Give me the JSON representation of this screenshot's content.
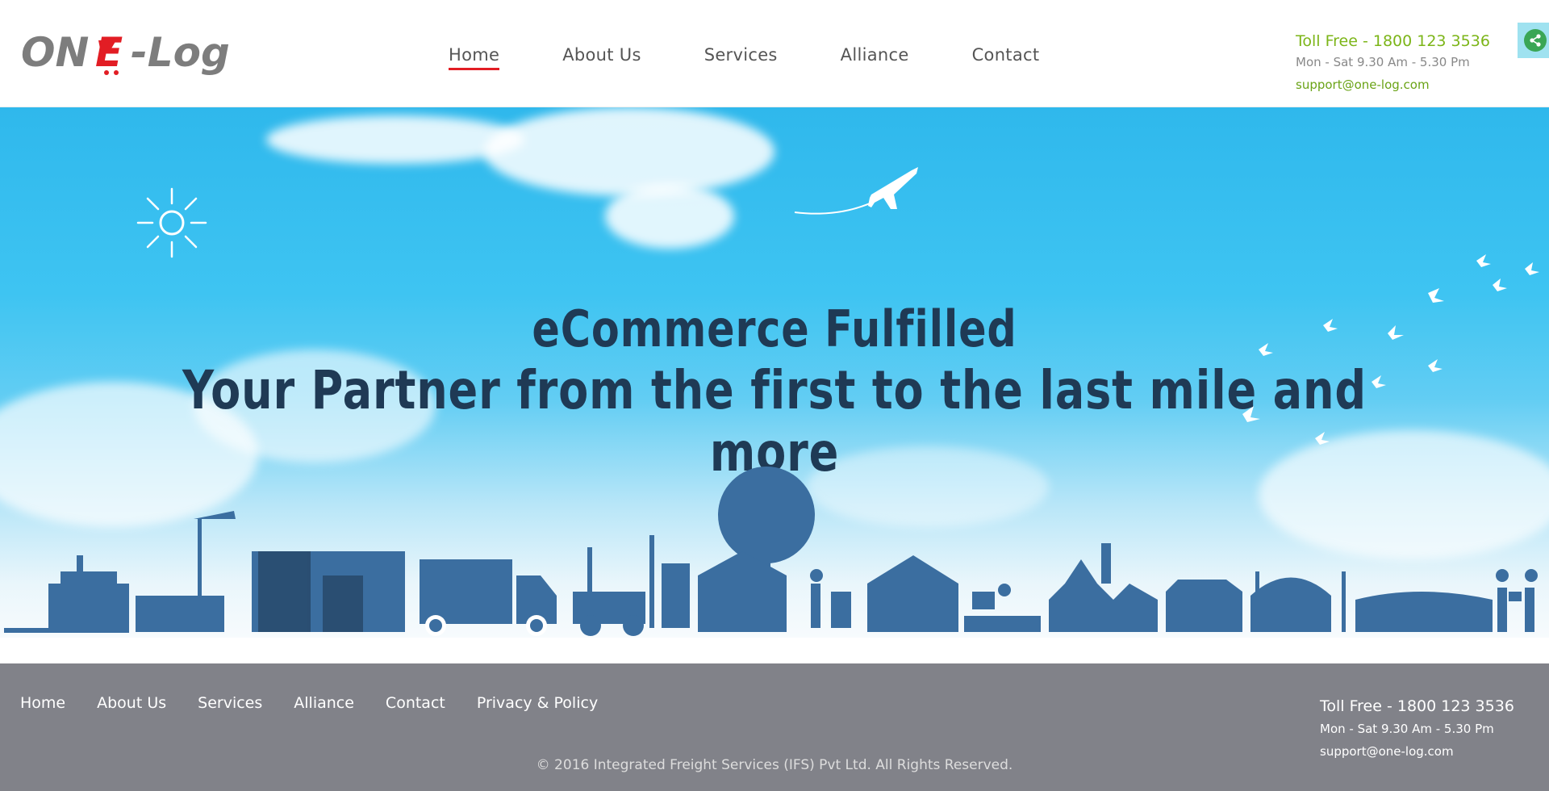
{
  "header": {
    "logo_text": "ONE-Log",
    "nav": [
      {
        "label": "Home",
        "active": true
      },
      {
        "label": "About Us"
      },
      {
        "label": "Services"
      },
      {
        "label": "Alliance"
      },
      {
        "label": "Contact"
      }
    ],
    "toll_free": "Toll Free - 1800 123 3536",
    "hours": "Mon - Sat 9.30 Am - 5.30 Pm",
    "email": "support@one-log.com",
    "share_icon": "share-icon"
  },
  "hero": {
    "title_line1": "eCommerce Fulfilled",
    "title_line2": "Your Partner from the first to  the  last mile and more"
  },
  "footer": {
    "nav": [
      "Home",
      "About Us",
      "Services",
      "Alliance",
      "Contact",
      "Privacy & Policy"
    ],
    "toll_free": "Toll Free - 1800 123 3536",
    "hours": "Mon - Sat 9.30 Am - 5.30 Pm",
    "email": "support@one-log.com",
    "copyright": "© 2016 Integrated Freight Services (IFS) Pvt Ltd. All Rights Reserved."
  },
  "colors": {
    "accent_red": "#e21d24",
    "accent_green": "#7cb518",
    "footer_bg": "#818289",
    "skyline_blue": "#3b6ea0"
  }
}
